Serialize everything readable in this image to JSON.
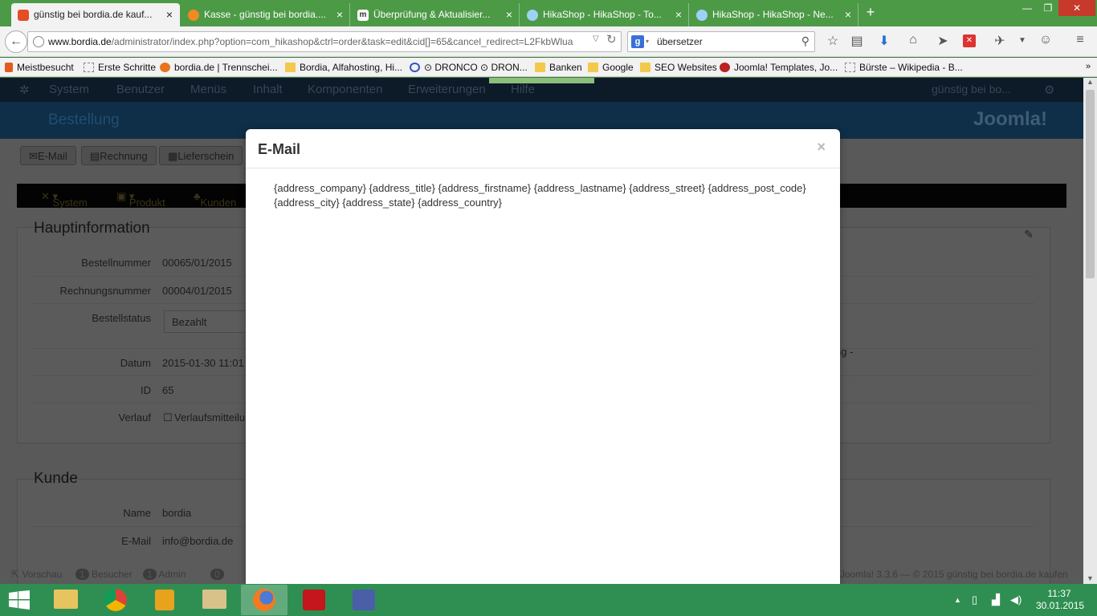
{
  "browser": {
    "tabs": [
      {
        "label": "günstig bei bordia.de kauf...",
        "active": true,
        "icon_color": "#e44d26"
      },
      {
        "label": "Kasse - günstig bei bordia....",
        "active": false,
        "icon_color": "#f08a24"
      },
      {
        "label": "Überprüfung & Aktualisier...",
        "active": false,
        "icon_color": "#333333"
      },
      {
        "label": "HikaShop - HikaShop - To...",
        "active": false,
        "icon_color": "#2b7bd6"
      },
      {
        "label": "HikaShop - HikaShop - Ne...",
        "active": false,
        "icon_color": "#2b7bd6"
      }
    ],
    "url_domain": "www.bordia.de",
    "url_rest": "/administrator/index.php?option=com_hikashop&ctrl=order&task=edit&cid[]=65&cancel_redirect=L2FkbWlua",
    "search_value": "übersetzer",
    "bookmarks": [
      "Meistbesucht",
      "Erste Schritte",
      "bordia.de | Trennschei...",
      "Bordia, Alfahosting, Hi...",
      "⊙ DRONCO ⊙ DRON...",
      "Banken",
      "Google",
      "SEO Websites",
      "Joomla! Templates, Jo...",
      "Bürste – Wikipedia - B..."
    ]
  },
  "joomla": {
    "menu": [
      "System",
      "Benutzer",
      "Menüs",
      "Inhalt",
      "Komponenten",
      "Erweiterungen",
      "Hilfe"
    ],
    "site_link": "günstig bei bo...",
    "page_title": "Bestellung",
    "logo_text": "Joomla!",
    "toolbar": [
      "E-Mail",
      "Rechnung",
      "Lieferschein"
    ],
    "hika_menu": [
      "System",
      "Produkt",
      "Kunden"
    ],
    "main_title": "Hauptinformation",
    "rows": [
      {
        "label": "Bestellnummer",
        "value": "00065/01/2015"
      },
      {
        "label": "Rechnungsnummer",
        "value": "00004/01/2015"
      },
      {
        "label": "Bestellstatus",
        "value": "Bezahlt"
      },
      {
        "label": "Datum",
        "value": "2015-01-30 11:01"
      },
      {
        "label": "ID",
        "value": "65"
      },
      {
        "label": "Verlauf",
        "value": "Verlaufsmitteilu"
      }
    ],
    "right_fragment": "ng -",
    "customer_title": "Kunde",
    "customer_rows": [
      {
        "label": "Name",
        "value": "bordia"
      },
      {
        "label": "E-Mail",
        "value": "info@bordia.de"
      }
    ],
    "status_bar": {
      "preview": "Vorschau",
      "visitors_count": "1",
      "visitors_label": "Besucher",
      "admin_count": "1",
      "admin_label": "Admin",
      "other_count": "0",
      "footer": "Joomla! 3.3.6 — © 2015 günstig bei bordia.de kaufen"
    }
  },
  "modal": {
    "title": "E-Mail",
    "close": "×",
    "body": "{address_company} {address_title} {address_firstname} {address_lastname} {address_street} {address_post_code} {address_city} {address_state} {address_country}"
  },
  "taskbar": {
    "time": "11:37",
    "date": "30.01.2015"
  }
}
